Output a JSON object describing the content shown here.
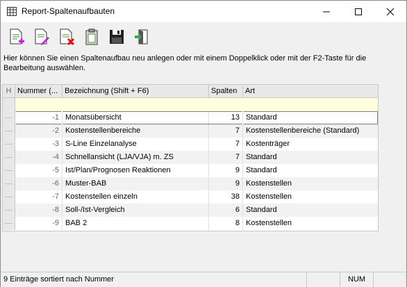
{
  "window": {
    "title": "Report-Spaltenaufbauten"
  },
  "toolbar": {
    "buttons": [
      {
        "name": "new-icon"
      },
      {
        "name": "edit-icon"
      },
      {
        "name": "delete-icon"
      },
      {
        "name": "paste-icon"
      },
      {
        "name": "save-icon"
      },
      {
        "name": "exit-icon"
      }
    ]
  },
  "description": "Hier können Sie einen Spaltenaufbau neu anlegen oder mit einem Doppelklick oder mit der F2-Taste für die Bearbeitung auswählen.",
  "table": {
    "header_marker": "H",
    "columns": [
      "Nummer (...",
      "Bezeichnung (Shift + F6)",
      "Spalten",
      "Art"
    ],
    "rows": [
      {
        "nummer": "-1",
        "bezeichnung": "Monatsübersicht",
        "spalten": "13",
        "art": "Standard"
      },
      {
        "nummer": "-2",
        "bezeichnung": "Kostenstellenbereiche",
        "spalten": "7",
        "art": "Kostenstellenbereiche (Standard)"
      },
      {
        "nummer": "-3",
        "bezeichnung": "S-Line Einzelanalyse",
        "spalten": "7",
        "art": "Kostenträger"
      },
      {
        "nummer": "-4",
        "bezeichnung": "Schnellansicht (LJA/VJA) m. ZS",
        "spalten": "7",
        "art": "Standard"
      },
      {
        "nummer": "-5",
        "bezeichnung": "Ist/Plan/Prognosen Reaktionen",
        "spalten": "9",
        "art": "Standard"
      },
      {
        "nummer": "-6",
        "bezeichnung": "Muster-BAB",
        "spalten": "9",
        "art": "Kostenstellen"
      },
      {
        "nummer": "-7",
        "bezeichnung": "Kostenstellen einzeln",
        "spalten": "38",
        "art": "Kostenstellen"
      },
      {
        "nummer": "-8",
        "bezeichnung": "Soll-/Ist-Vergleich",
        "spalten": "6",
        "art": "Standard"
      },
      {
        "nummer": "-9",
        "bezeichnung": "BAB 2",
        "spalten": "8",
        "art": "Kostenstellen"
      }
    ]
  },
  "statusbar": {
    "text": "9 Einträge sortiert nach Nummer",
    "num": "NUM"
  }
}
